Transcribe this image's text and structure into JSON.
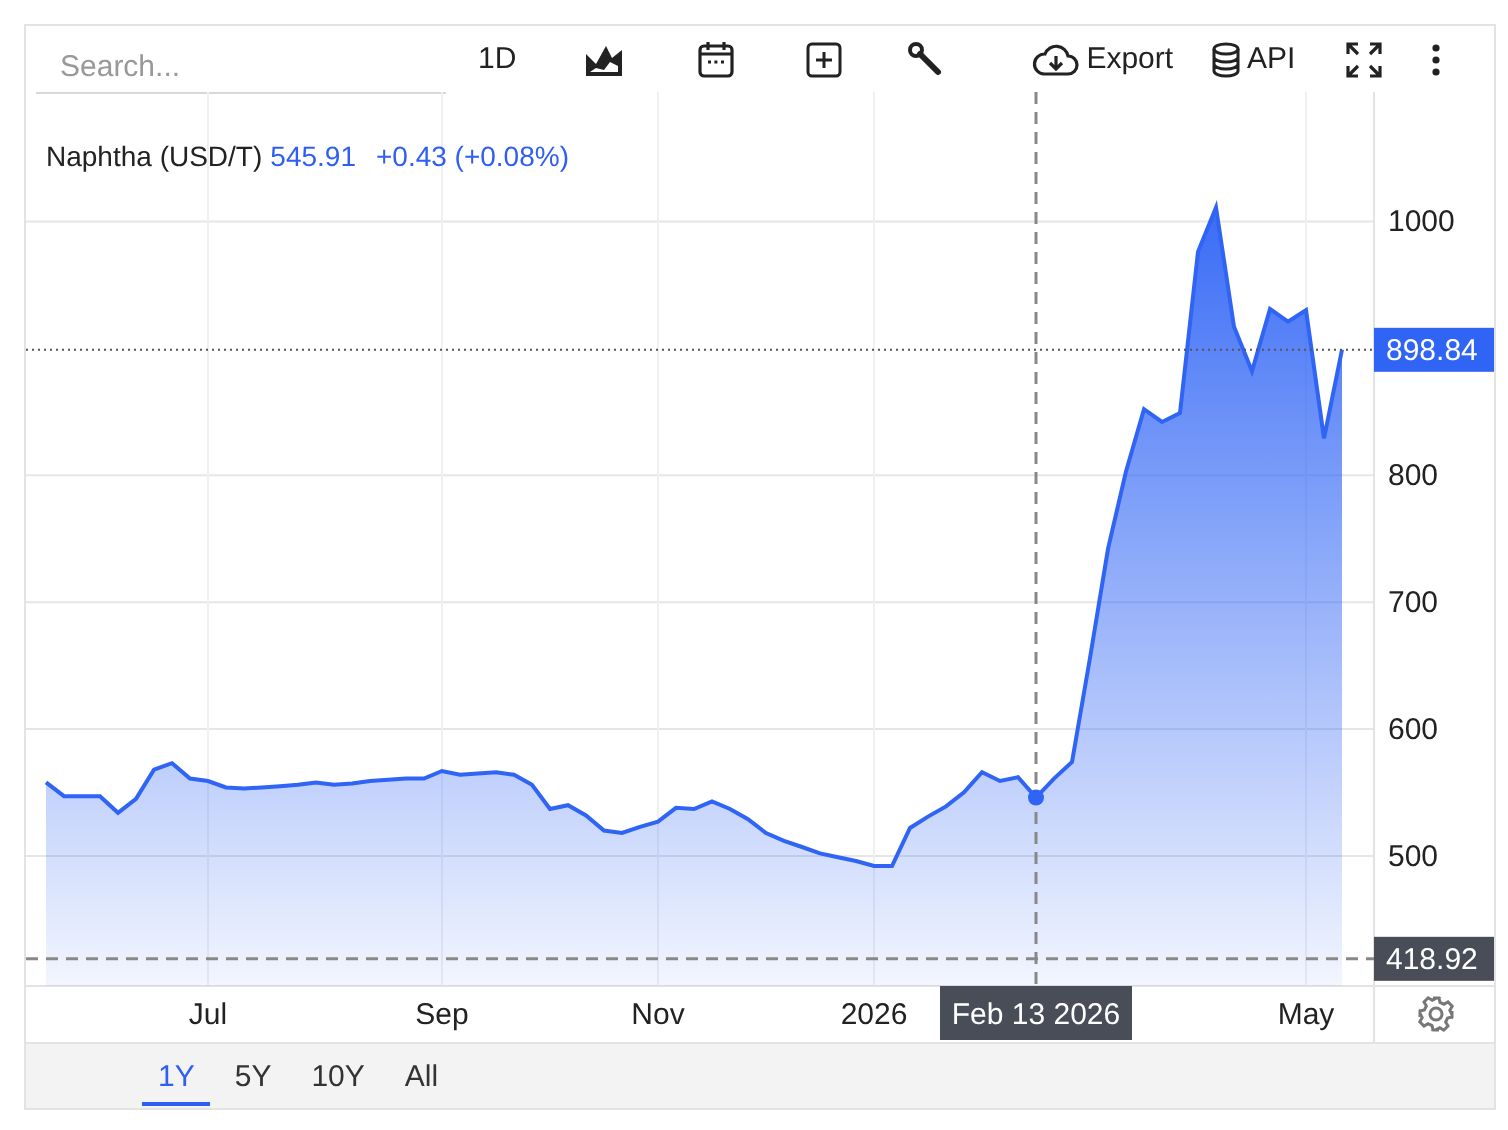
{
  "toolbar": {
    "search": {
      "placeholder": "Search..."
    },
    "interval": "1D",
    "export": "Export",
    "api": "API"
  },
  "legend": {
    "name": "Naphtha (USD/T)",
    "price": "545.91",
    "change": "+0.43 (+0.08%)"
  },
  "chart": {
    "crosshair": {
      "x_label": "Feb 13 2026"
    },
    "chart_data": {
      "type": "area",
      "grid": true,
      "ylim": [
        397.5,
        1102
      ],
      "categories": [
        null,
        null,
        null,
        null,
        null,
        null,
        null,
        null,
        null,
        "Jul",
        null,
        null,
        null,
        null,
        null,
        null,
        null,
        null,
        null,
        null,
        null,
        null,
        "Sep",
        null,
        null,
        null,
        null,
        null,
        null,
        null,
        null,
        null,
        null,
        null,
        "Nov",
        null,
        null,
        null,
        null,
        null,
        null,
        null,
        null,
        null,
        null,
        null,
        "2026",
        null,
        null,
        null,
        null,
        null,
        null,
        null,
        null,
        null,
        null,
        null,
        null,
        null,
        null,
        null,
        null,
        null,
        null,
        null,
        null,
        null,
        null,
        null,
        "May",
        null,
        null
      ],
      "yticks": [
        500,
        600,
        700,
        800,
        1000
      ],
      "ref_lines": [
        {
          "axis": "y",
          "value": 898.84,
          "label": "898.84"
        },
        {
          "axis": "y",
          "value": 418.92,
          "label": "418.92"
        }
      ],
      "series": [
        {
          "color": "#2f64f5",
          "values": [
            558,
            547,
            547,
            547,
            534,
            545,
            568,
            573,
            561,
            559,
            554,
            553,
            554,
            555,
            556,
            558,
            556,
            557,
            559,
            560,
            561,
            561,
            567,
            564,
            565,
            566,
            564,
            556,
            537,
            540,
            532,
            520,
            518,
            523,
            527,
            538,
            537,
            543,
            537,
            529,
            518,
            512,
            507,
            502,
            499,
            496,
            492,
            492,
            522,
            531,
            539,
            550,
            566,
            559,
            562,
            546,
            561,
            574,
            656,
            742,
            803,
            852,
            842,
            849,
            976,
            1011,
            917,
            882,
            931,
            921,
            930,
            829,
            899
          ]
        }
      ]
    }
  },
  "ranges": [
    {
      "label": "1Y",
      "selected": true
    },
    {
      "label": "5Y",
      "selected": false
    },
    {
      "label": "10Y",
      "selected": false
    },
    {
      "label": "All",
      "selected": false
    }
  ]
}
